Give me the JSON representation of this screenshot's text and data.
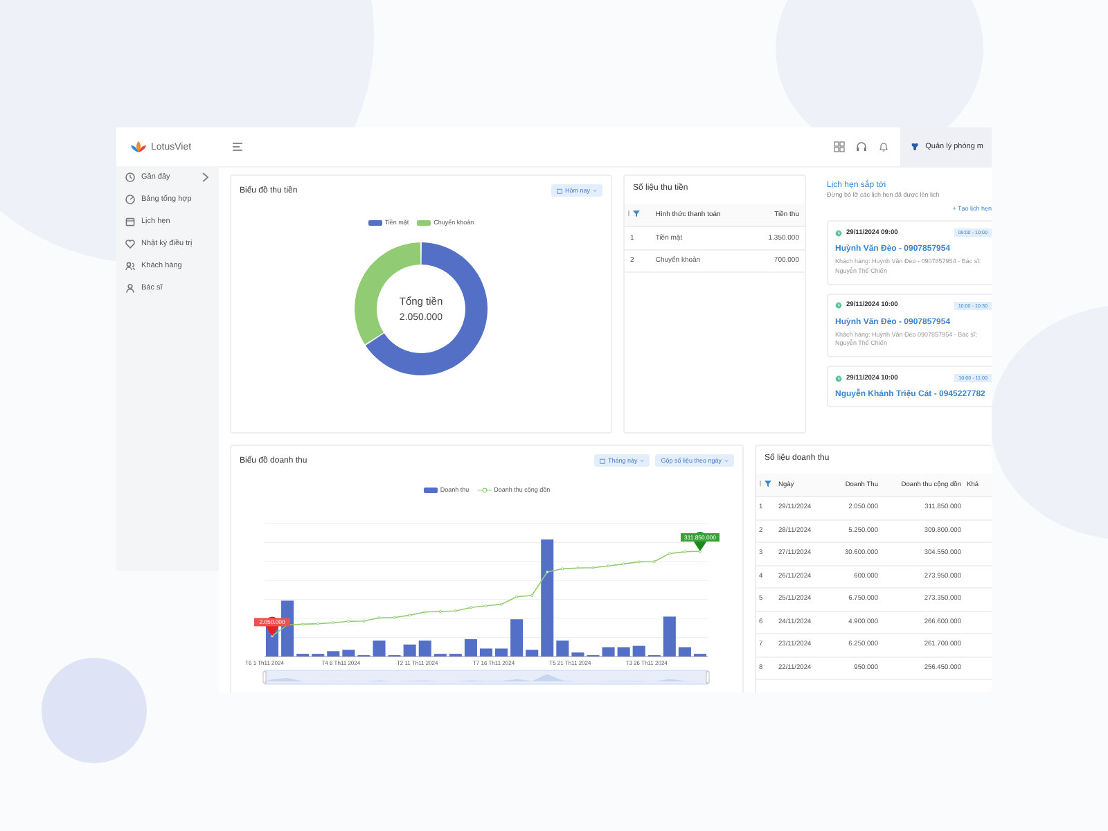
{
  "sidebar": {
    "logo": "LotusViet",
    "items": [
      {
        "label": "Gần đây",
        "expandable": true
      },
      {
        "label": "Bảng tổng hợp",
        "expandable": false
      },
      {
        "label": "Lịch hẹn",
        "expandable": false
      },
      {
        "label": "Nhật ký điều trị",
        "expandable": false
      },
      {
        "label": "Khách hàng",
        "expandable": false
      },
      {
        "label": "Bác sĩ",
        "expandable": false
      }
    ]
  },
  "header": {
    "user_label": "Quản lý phòng m"
  },
  "payment_chart": {
    "title": "Biểu đồ thu tiền",
    "filter": "Hôm nay",
    "legend": [
      {
        "label": "Tiền mặt",
        "color": "#5470c6"
      },
      {
        "label": "Chuyển khoản",
        "color": "#91cc75"
      }
    ],
    "center_label": "Tổng tiền",
    "center_value": "2.050.000"
  },
  "payment_table": {
    "title": "Số liệu thu tiền",
    "columns": [
      "Hình thức thanh toán",
      "Tiền thu"
    ],
    "rows": [
      {
        "index": "1",
        "method": "Tiền mặt",
        "amount": "1.350.000"
      },
      {
        "index": "2",
        "method": "Chuyển khoản",
        "amount": "700.000"
      }
    ]
  },
  "appointments": {
    "title": "Lịch hẹn sắp tới",
    "subtitle": "Đừng bỏ lỡ các lịch hẹn đã được lên lịch",
    "create_link": "+ Tạo lịch hẹn",
    "items": [
      {
        "datetime": "29/11/2024 09:00",
        "slot": "09:00 - 10:00",
        "name": "Huỳnh Văn Đèo - 0907857954",
        "detail": "Khách hàng: Huỳnh Văn Đèo - 0907857954 - Bác sĩ: Nguyễn Thế Chiến"
      },
      {
        "datetime": "29/11/2024 10:00",
        "slot": "10:00 - 10:30",
        "name": "Huỳnh Văn Đèo - 0907857954",
        "detail": "Khách hàng: Huỳnh Văn Đèo 0907857954 - Bác sĩ: Nguyễn Thế Chiến"
      },
      {
        "datetime": "29/11/2024 10:00",
        "slot": "10:00 - 11:00",
        "name": "Nguyễn Khánh Triệu Cát - 0945227782"
      }
    ]
  },
  "revenue_chart": {
    "title": "Biểu đồ doanh thu",
    "filters": [
      "Tháng này",
      "Gộp số liệu theo ngày"
    ],
    "legend": [
      {
        "label": "Doanh thu",
        "kind": "bar",
        "color": "#5470c6"
      },
      {
        "label": "Doanh thu cộng dồn",
        "kind": "line",
        "color": "#91cc75"
      }
    ],
    "x_labels": [
      "T6 1 Th11 2024",
      "T4 6 Th11 2024",
      "T2 11 Th11 2024",
      "T7 16 Th11 2024",
      "T5 21 Th11 2024",
      "T3 26 Th11 2024"
    ],
    "min_marker": "2.050.000",
    "max_marker": "311.850.000"
  },
  "revenue_table": {
    "title": "Số liệu doanh thu",
    "columns": [
      "Ngày",
      "Doanh Thu",
      "Doanh thu cộng dồn",
      "Khá"
    ],
    "rows": [
      {
        "index": "1",
        "date": "29/11/2024",
        "revenue": "2.050.000",
        "cumulative": "311.850.000"
      },
      {
        "index": "2",
        "date": "28/11/2024",
        "revenue": "5.250.000",
        "cumulative": "309.800.000"
      },
      {
        "index": "3",
        "date": "27/11/2024",
        "revenue": "30.600.000",
        "cumulative": "304.550.000"
      },
      {
        "index": "4",
        "date": "26/11/2024",
        "revenue": "600.000",
        "cumulative": "273.950.000"
      },
      {
        "index": "5",
        "date": "25/11/2024",
        "revenue": "6.750.000",
        "cumulative": "273.350.000"
      },
      {
        "index": "6",
        "date": "24/11/2024",
        "revenue": "4.900.000",
        "cumulative": "266.600.000"
      },
      {
        "index": "7",
        "date": "23/11/2024",
        "revenue": "6.250.000",
        "cumulative": "261.700.000"
      },
      {
        "index": "8",
        "date": "22/11/2024",
        "revenue": "950.000",
        "cumulative": "256.450.000"
      }
    ]
  }
}
